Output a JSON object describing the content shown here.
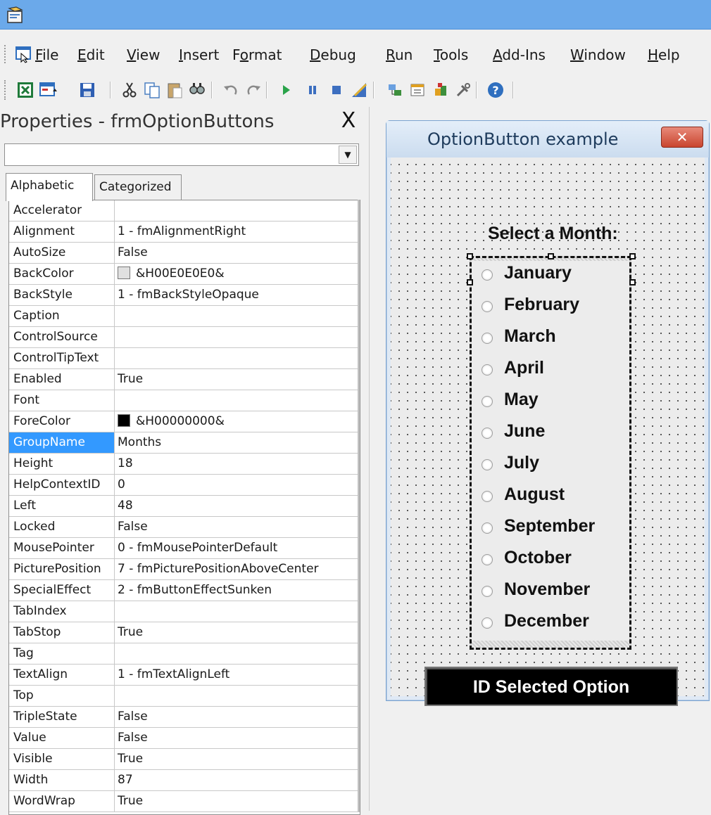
{
  "menubar": {
    "items": [
      {
        "pre": "",
        "u": "F",
        "post": "ile"
      },
      {
        "pre": "",
        "u": "E",
        "post": "dit"
      },
      {
        "pre": "",
        "u": "V",
        "post": "iew"
      },
      {
        "pre": "",
        "u": "I",
        "post": "nsert"
      },
      {
        "pre": "F",
        "u": "o",
        "post": "rmat"
      },
      {
        "pre": "",
        "u": "D",
        "post": "ebug"
      },
      {
        "pre": "",
        "u": "R",
        "post": "un"
      },
      {
        "pre": "",
        "u": "T",
        "post": "ools"
      },
      {
        "pre": "",
        "u": "A",
        "post": "dd-Ins"
      },
      {
        "pre": "",
        "u": "W",
        "post": "indow"
      },
      {
        "pre": "",
        "u": "H",
        "post": "elp"
      }
    ]
  },
  "toolbar": {
    "icons": [
      "view-excel-icon",
      "insert-userform-icon",
      "save-icon",
      "cut-icon",
      "copy-icon",
      "paste-icon",
      "find-icon",
      "undo-icon",
      "redo-icon",
      "run-icon",
      "break-icon",
      "reset-icon",
      "design-mode-icon",
      "project-explorer-icon",
      "properties-window-icon",
      "object-browser-icon",
      "toolbox-icon",
      "help-icon"
    ]
  },
  "properties": {
    "title": "Properties - frmOptionButtons",
    "close": "X",
    "tabs": {
      "alphabetic": "Alphabetic",
      "categorized": "Categorized"
    },
    "rows": [
      {
        "name": "Accelerator",
        "value": ""
      },
      {
        "name": "Alignment",
        "value": "1 - fmAlignmentRight"
      },
      {
        "name": "AutoSize",
        "value": "False"
      },
      {
        "name": "BackColor",
        "value": "&H00E0E0E0&",
        "swatch": "#e0e0e0"
      },
      {
        "name": "BackStyle",
        "value": "1 - fmBackStyleOpaque"
      },
      {
        "name": "Caption",
        "value": ""
      },
      {
        "name": "ControlSource",
        "value": ""
      },
      {
        "name": "ControlTipText",
        "value": ""
      },
      {
        "name": "Enabled",
        "value": "True"
      },
      {
        "name": "Font",
        "value": ""
      },
      {
        "name": "ForeColor",
        "value": "&H00000000&",
        "swatch": "#000000"
      },
      {
        "name": "GroupName",
        "value": "Months",
        "selected": true
      },
      {
        "name": "Height",
        "value": "18"
      },
      {
        "name": "HelpContextID",
        "value": "0"
      },
      {
        "name": "Left",
        "value": "48"
      },
      {
        "name": "Locked",
        "value": "False"
      },
      {
        "name": "MousePointer",
        "value": "0 - fmMousePointerDefault"
      },
      {
        "name": "PicturePosition",
        "value": "7 - fmPicturePositionAboveCenter"
      },
      {
        "name": "SpecialEffect",
        "value": "2 - fmButtonEffectSunken"
      },
      {
        "name": "TabIndex",
        "value": ""
      },
      {
        "name": "TabStop",
        "value": "True"
      },
      {
        "name": "Tag",
        "value": ""
      },
      {
        "name": "TextAlign",
        "value": "1 - fmTextAlignLeft"
      },
      {
        "name": "Top",
        "value": ""
      },
      {
        "name": "TripleState",
        "value": "False"
      },
      {
        "name": "Value",
        "value": "False"
      },
      {
        "name": "Visible",
        "value": "True"
      },
      {
        "name": "Width",
        "value": "87"
      },
      {
        "name": "WordWrap",
        "value": "True"
      }
    ]
  },
  "form": {
    "title": "OptionButton example",
    "close": "✕",
    "heading": "Select a Month:",
    "months": [
      "January",
      "February",
      "March",
      "April",
      "May",
      "June",
      "July",
      "August",
      "September",
      "October",
      "November",
      "December"
    ],
    "button": "ID Selected Option"
  },
  "colors": {
    "titlebar": "#6ba9ea",
    "selection": "#3399ff",
    "form_title_text": "#1e3b5c"
  }
}
